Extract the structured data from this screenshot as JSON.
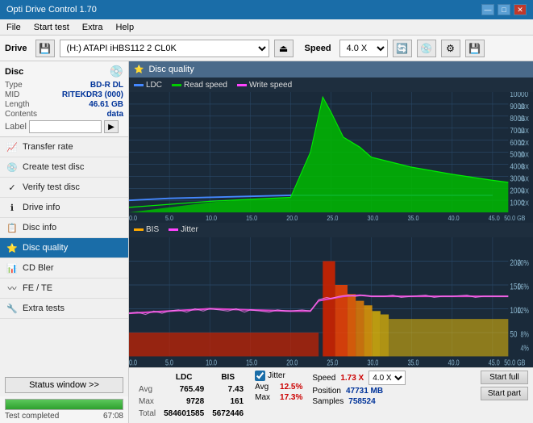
{
  "app": {
    "title": "Opti Drive Control 1.70",
    "titlebar_controls": [
      "—",
      "□",
      "✕"
    ]
  },
  "menu": {
    "items": [
      "File",
      "Start test",
      "Extra",
      "Help"
    ]
  },
  "drive_toolbar": {
    "drive_label": "Drive",
    "drive_value": "(H:) ATAPI iHBS112  2 CL0K",
    "speed_label": "Speed",
    "speed_value": "4.0 X"
  },
  "disc_info": {
    "section_label": "Disc",
    "type_label": "Type",
    "type_value": "BD-R DL",
    "mid_label": "MID",
    "mid_value": "RITEKDR3 (000)",
    "length_label": "Length",
    "length_value": "46.61 GB",
    "contents_label": "Contents",
    "contents_value": "data",
    "label_label": "Label"
  },
  "nav": {
    "items": [
      {
        "id": "transfer-rate",
        "label": "Transfer rate",
        "icon": "📈"
      },
      {
        "id": "create-test-disc",
        "label": "Create test disc",
        "icon": "💿"
      },
      {
        "id": "verify-test-disc",
        "label": "Verify test disc",
        "icon": "✓"
      },
      {
        "id": "drive-info",
        "label": "Drive info",
        "icon": "ℹ"
      },
      {
        "id": "disc-info",
        "label": "Disc info",
        "icon": "📋"
      },
      {
        "id": "disc-quality",
        "label": "Disc quality",
        "icon": "⭐",
        "active": true
      },
      {
        "id": "cd-bler",
        "label": "CD Bler",
        "icon": "📊"
      },
      {
        "id": "fe-te",
        "label": "FE / TE",
        "icon": "〰"
      },
      {
        "id": "extra-tests",
        "label": "Extra tests",
        "icon": "🔧"
      }
    ]
  },
  "status_window_btn": "Status window >>",
  "progress": {
    "percent": 100,
    "status": "Test completed",
    "time": "67:08"
  },
  "chart": {
    "title": "Disc quality",
    "icon": "⭐",
    "legend_top": [
      "LDC",
      "Read speed",
      "Write speed"
    ],
    "legend_bottom": [
      "BIS",
      "Jitter"
    ],
    "y_max_top": 10000,
    "y_min_top": 0,
    "y_max_bottom": 200,
    "y_min_bottom": 0,
    "x_max": 50,
    "x_label": "GB"
  },
  "stats": {
    "headers": [
      "",
      "LDC",
      "BIS"
    ],
    "rows": [
      {
        "label": "Avg",
        "ldc": "765.49",
        "bis": "7.43"
      },
      {
        "label": "Max",
        "ldc": "9728",
        "bis": "161"
      },
      {
        "label": "Total",
        "ldc": "584601585",
        "bis": "5672446"
      }
    ],
    "jitter_label": "Jitter",
    "jitter_avg": "12.5%",
    "jitter_max": "17.3%",
    "speed_label": "Speed",
    "speed_value": "1.73 X",
    "speed_select": "4.0 X",
    "position_label": "Position",
    "position_value": "47731 MB",
    "samples_label": "Samples",
    "samples_value": "758524",
    "start_full_label": "Start full",
    "start_part_label": "Start part"
  },
  "colors": {
    "accent": "#1a6da8",
    "chart_bg": "#1a2a3a",
    "grid": "#2a4a6a",
    "ldc": "#4488ff",
    "read_speed": "#00cc00",
    "write_speed": "#ff44ff",
    "bis_red": "#cc2200",
    "bis_orange": "#ff8800",
    "bis_yellow": "#ffcc00",
    "jitter": "#dd44cc",
    "title_bar": "#4a6a8a"
  }
}
